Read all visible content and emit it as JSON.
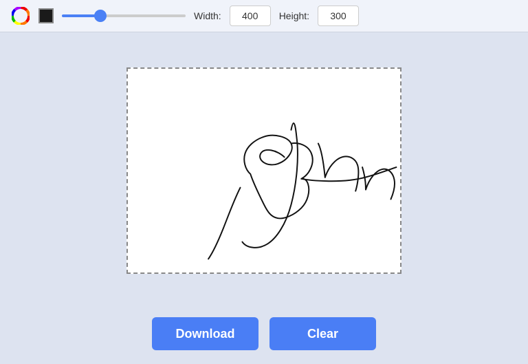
{
  "toolbar": {
    "width_label": "Width:",
    "height_label": "Height:",
    "width_value": "400",
    "height_value": "300",
    "slider_value": 30,
    "slider_min": 1,
    "slider_max": 100
  },
  "buttons": {
    "download_label": "Download",
    "clear_label": "Clear"
  },
  "canvas": {
    "aria_label": "Signature canvas"
  },
  "icons": {
    "color_wheel": "color-wheel-icon",
    "color_swatch": "color-swatch-icon"
  }
}
